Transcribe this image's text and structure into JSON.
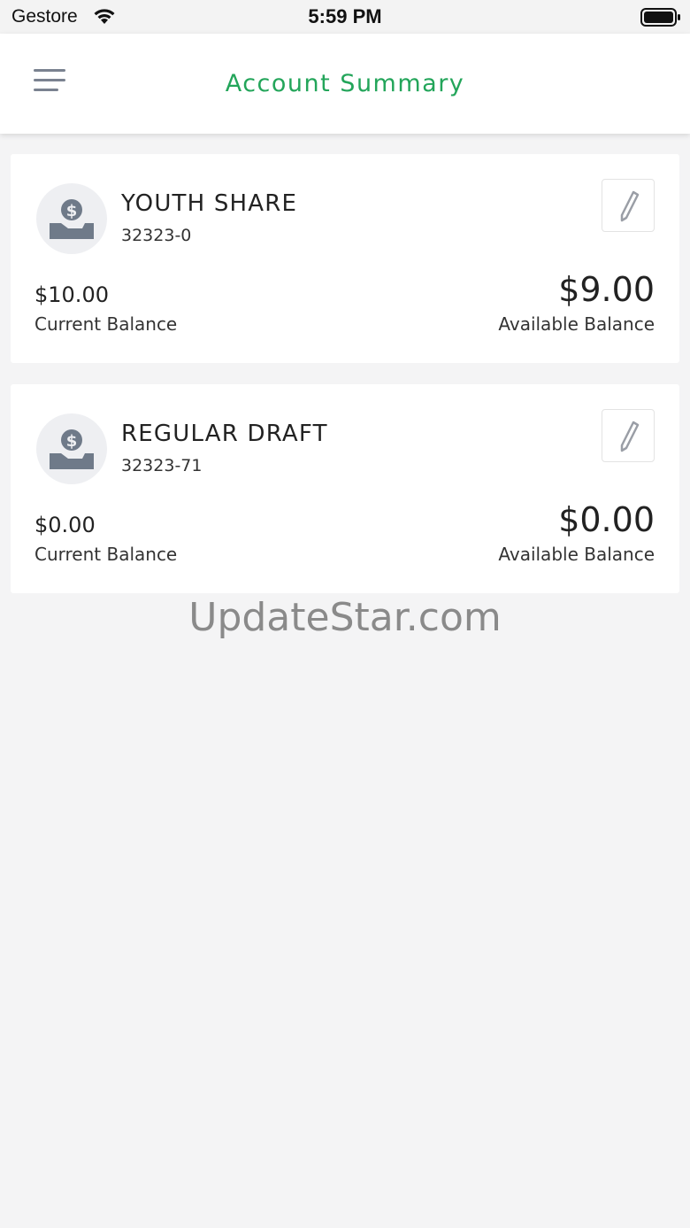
{
  "status_bar": {
    "carrier": "Gestore",
    "time": "5:59 PM",
    "icons": [
      "wifi-icon",
      "battery-icon"
    ]
  },
  "header": {
    "menu_icon": "hamburger-menu-icon",
    "title": "Account Summary",
    "title_color": "#23a55a"
  },
  "accounts": [
    {
      "name": "YOUTH SHARE",
      "number": "32323-0",
      "current_balance": "$10.00",
      "current_label": "Current Balance",
      "available_balance": "$9.00",
      "available_label": "Available Balance",
      "avatar_icon": "money-in-hand-icon",
      "edit_icon": "pencil-icon"
    },
    {
      "name": "REGULAR DRAFT",
      "number": "32323-71",
      "current_balance": "$0.00",
      "current_label": "Current Balance",
      "available_balance": "$0.00",
      "available_label": "Available Balance",
      "avatar_icon": "money-in-hand-icon",
      "edit_icon": "pencil-icon"
    }
  ],
  "watermark": "UpdateStar.com"
}
